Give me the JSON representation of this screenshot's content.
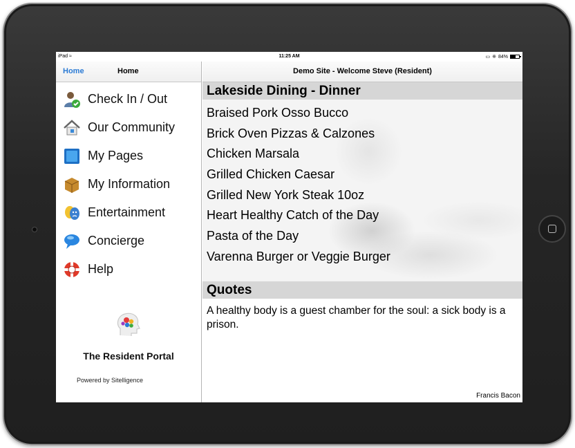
{
  "status_bar": {
    "device": "iPad",
    "time": "11:25 AM",
    "battery": "84%"
  },
  "sidebar": {
    "back_label": "Home",
    "title": "Home",
    "items": [
      {
        "label": "Check In / Out",
        "icon": "person-check-icon"
      },
      {
        "label": "Our Community",
        "icon": "house-icon"
      },
      {
        "label": "My Pages",
        "icon": "blue-square-icon"
      },
      {
        "label": "My Information",
        "icon": "box-icon"
      },
      {
        "label": "Entertainment",
        "icon": "theater-masks-icon"
      },
      {
        "label": "Concierge",
        "icon": "speech-bubble-icon"
      },
      {
        "label": "Help",
        "icon": "lifebuoy-icon"
      }
    ],
    "brand_name": "The Resident Portal",
    "powered_by": "Powered by Sitelligence"
  },
  "main": {
    "header_title": "Demo Site - Welcome Steve (Resident)",
    "dining": {
      "title": "Lakeside Dining - Dinner",
      "items": [
        "Braised Pork Osso Bucco",
        "Brick Oven Pizzas & Calzones",
        "Chicken Marsala",
        "Grilled Chicken Caesar",
        "Grilled New York Steak 10oz",
        "Heart Healthy Catch of the Day",
        "Pasta of the Day",
        "Varenna Burger or Veggie Burger"
      ]
    },
    "quotes": {
      "title": "Quotes",
      "text": "A healthy body is a guest chamber for the soul: a sick body is a prison.",
      "author": "Francis Bacon"
    }
  },
  "colors": {
    "link_blue": "#2a7ad4",
    "section_bar": "#d6d6d6",
    "device_frame": "#262626"
  }
}
